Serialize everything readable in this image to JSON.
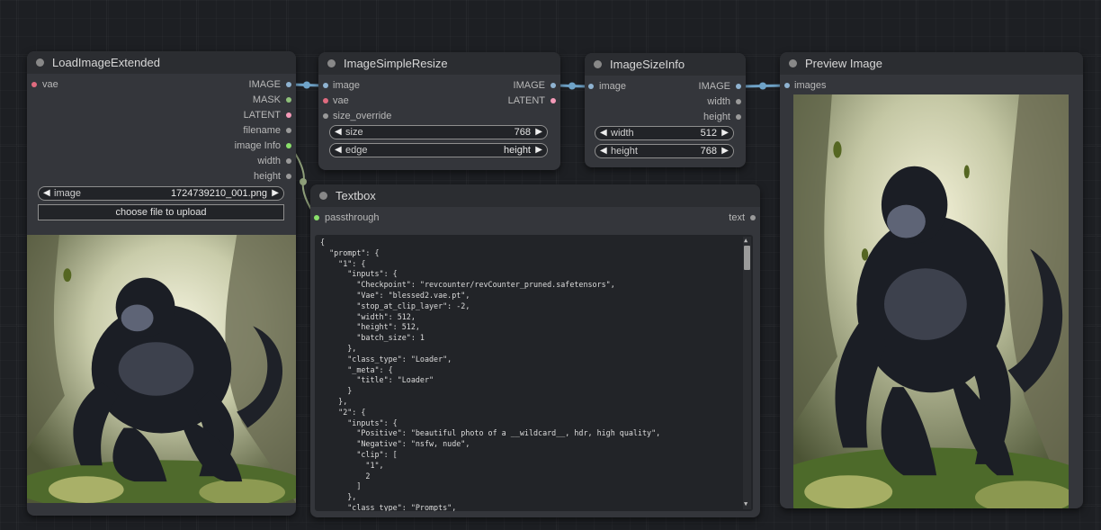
{
  "colors": {
    "canvas": "#1d1f23",
    "node_body": "#34363b",
    "node_title": "#2b2d31",
    "link_image": "#6fa3c8",
    "socket_image": "#8fb3d1",
    "socket_vae": "#e06b7f",
    "socket_mask": "#8fc17a",
    "socket_latent": "#f59ab8",
    "socket_string": "#8ae06b",
    "socket_int": "#9a9a9a"
  },
  "nodes": {
    "load_image": {
      "title": "LoadImageExtended",
      "inputs": [
        {
          "label": "vae"
        }
      ],
      "outputs": [
        {
          "label": "IMAGE"
        },
        {
          "label": "MASK"
        },
        {
          "label": "LATENT"
        },
        {
          "label": "filename"
        },
        {
          "label": "image Info"
        },
        {
          "label": "width"
        },
        {
          "label": "height"
        }
      ],
      "widget": {
        "label": "image",
        "value": "1724739210_001.png"
      },
      "upload_label": "choose file to upload"
    },
    "resize": {
      "title": "ImageSimpleResize",
      "inputs": [
        {
          "label": "image"
        },
        {
          "label": "vae"
        },
        {
          "label": "size_override"
        }
      ],
      "outputs": [
        {
          "label": "IMAGE"
        },
        {
          "label": "LATENT"
        }
      ],
      "widgets": [
        {
          "label": "size",
          "value": "768"
        },
        {
          "label": "edge",
          "value": "height"
        }
      ]
    },
    "size_info": {
      "title": "ImageSizeInfo",
      "inputs": [
        {
          "label": "image"
        }
      ],
      "outputs": [
        {
          "label": "IMAGE"
        },
        {
          "label": "width"
        },
        {
          "label": "height"
        }
      ],
      "widgets": [
        {
          "label": "width",
          "value": "512"
        },
        {
          "label": "height",
          "value": "768"
        }
      ]
    },
    "textbox": {
      "title": "Textbox",
      "inputs": [
        {
          "label": "passthrough"
        }
      ],
      "outputs": [
        {
          "label": "text"
        }
      ],
      "content": "{\n  \"prompt\": {\n    \"1\": {\n      \"inputs\": {\n        \"Checkpoint\": \"revcounter/revCounter_pruned.safetensors\",\n        \"Vae\": \"blessed2.vae.pt\",\n        \"stop_at_clip_layer\": -2,\n        \"width\": 512,\n        \"height\": 512,\n        \"batch_size\": 1\n      },\n      \"class_type\": \"Loader\",\n      \"_meta\": {\n        \"title\": \"Loader\"\n      }\n    },\n    \"2\": {\n      \"inputs\": {\n        \"Positive\": \"beautiful photo of a __wildcard__, hdr, high quality\",\n        \"Negative\": \"nsfw, nude\",\n        \"clip\": [\n          \"1\",\n          2\n        ]\n      },\n      \"class_type\": \"Prompts\","
    },
    "preview": {
      "title": "Preview Image",
      "inputs": [
        {
          "label": "images"
        }
      ]
    }
  },
  "images": {
    "subject": "gorilla-illustration"
  }
}
